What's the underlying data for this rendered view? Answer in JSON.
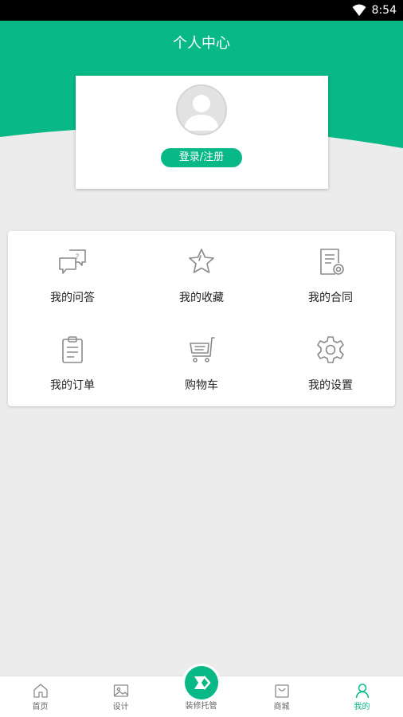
{
  "status_bar": {
    "time": "8:54"
  },
  "header": {
    "title": "个人中心"
  },
  "profile": {
    "login_label": "登录/注册"
  },
  "menu": {
    "items": [
      {
        "label": "我的问答",
        "icon": "qa-bubble-icon"
      },
      {
        "label": "我的收藏",
        "icon": "star-icon"
      },
      {
        "label": "我的合同",
        "icon": "contract-icon"
      },
      {
        "label": "我的订单",
        "icon": "clipboard-icon"
      },
      {
        "label": "购物车",
        "icon": "cart-icon"
      },
      {
        "label": "我的设置",
        "icon": "gear-icon"
      }
    ]
  },
  "bottom_nav": {
    "items": [
      {
        "label": "首页",
        "icon": "home-icon"
      },
      {
        "label": "设计",
        "icon": "image-icon"
      },
      {
        "label": "装修托管",
        "icon": "brand-logo-icon"
      },
      {
        "label": "商城",
        "icon": "shopping-bag-icon"
      },
      {
        "label": "我的",
        "icon": "user-icon",
        "active": true
      }
    ]
  },
  "colors": {
    "primary": "#08b886",
    "background": "#ececec",
    "icon_gray": "#8a8a8a"
  }
}
